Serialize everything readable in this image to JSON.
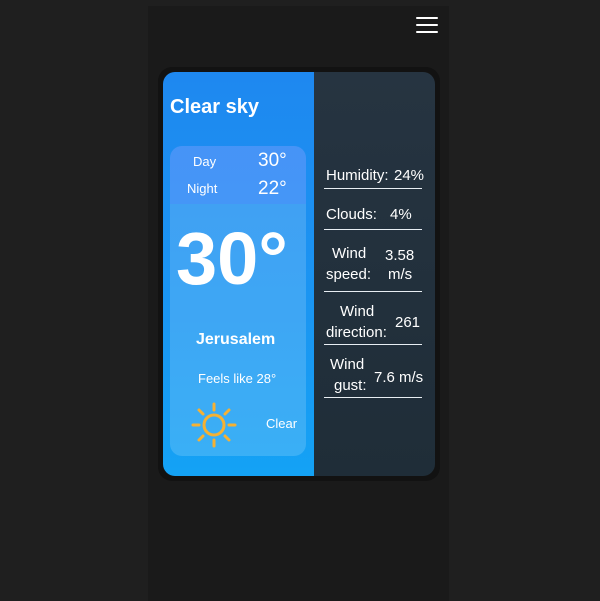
{
  "header": {
    "menu_icon": "hamburger-menu-icon"
  },
  "weather": {
    "title": "Clear sky",
    "day_label": "Day",
    "day_temp": "30°",
    "night_label": "Night",
    "night_temp": "22°",
    "current_temp": "30°",
    "city": "Jerusalem",
    "feels_like": "Feels like 28°",
    "condition_icon": "sun-icon",
    "condition": "Clear"
  },
  "details": {
    "humidity_label": "Humidity:",
    "humidity_value": "24%",
    "clouds_label": "Clouds:",
    "clouds_value": "4%",
    "wind_speed_label_1": "Wind",
    "wind_speed_label_2": "speed:",
    "wind_speed_value_1": "3.58",
    "wind_speed_value_2": "m/s",
    "wind_dir_label_1": "Wind",
    "wind_dir_label_2": "direction:",
    "wind_dir_value": "261",
    "wind_gust_label_1": "Wind",
    "wind_gust_label_2": "gust:",
    "wind_gust_value": "7.6 m/s"
  },
  "colors": {
    "page_bg": "#1f1f1f",
    "card_left_top": "#1e88f0",
    "card_left_bottom": "#14a2f5",
    "card_right": "#263441",
    "sun": "#f5b133"
  }
}
